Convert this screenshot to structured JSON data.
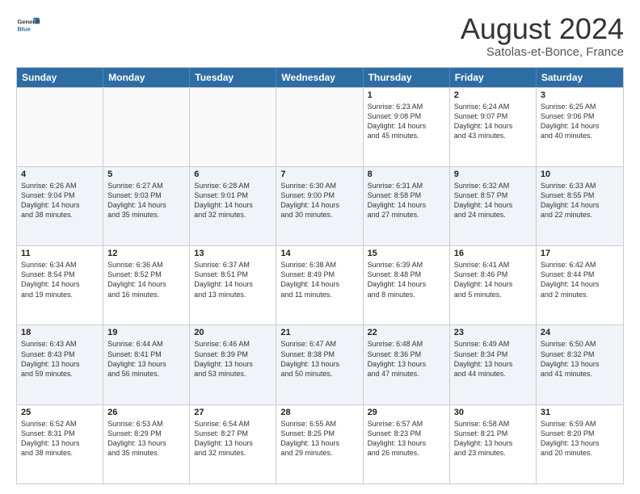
{
  "logo": {
    "general": "General",
    "blue": "Blue"
  },
  "title": "August 2024",
  "subtitle": "Satolas-et-Bonce, France",
  "header_days": [
    "Sunday",
    "Monday",
    "Tuesday",
    "Wednesday",
    "Thursday",
    "Friday",
    "Saturday"
  ],
  "rows": [
    [
      {
        "day": "",
        "text": "",
        "empty": true
      },
      {
        "day": "",
        "text": "",
        "empty": true
      },
      {
        "day": "",
        "text": "",
        "empty": true
      },
      {
        "day": "",
        "text": "",
        "empty": true
      },
      {
        "day": "1",
        "text": "Sunrise: 6:23 AM\nSunset: 9:08 PM\nDaylight: 14 hours\nand 45 minutes.",
        "empty": false
      },
      {
        "day": "2",
        "text": "Sunrise: 6:24 AM\nSunset: 9:07 PM\nDaylight: 14 hours\nand 43 minutes.",
        "empty": false
      },
      {
        "day": "3",
        "text": "Sunrise: 6:25 AM\nSunset: 9:06 PM\nDaylight: 14 hours\nand 40 minutes.",
        "empty": false
      }
    ],
    [
      {
        "day": "4",
        "text": "Sunrise: 6:26 AM\nSunset: 9:04 PM\nDaylight: 14 hours\nand 38 minutes.",
        "empty": false
      },
      {
        "day": "5",
        "text": "Sunrise: 6:27 AM\nSunset: 9:03 PM\nDaylight: 14 hours\nand 35 minutes.",
        "empty": false
      },
      {
        "day": "6",
        "text": "Sunrise: 6:28 AM\nSunset: 9:01 PM\nDaylight: 14 hours\nand 32 minutes.",
        "empty": false
      },
      {
        "day": "7",
        "text": "Sunrise: 6:30 AM\nSunset: 9:00 PM\nDaylight: 14 hours\nand 30 minutes.",
        "empty": false
      },
      {
        "day": "8",
        "text": "Sunrise: 6:31 AM\nSunset: 8:58 PM\nDaylight: 14 hours\nand 27 minutes.",
        "empty": false
      },
      {
        "day": "9",
        "text": "Sunrise: 6:32 AM\nSunset: 8:57 PM\nDaylight: 14 hours\nand 24 minutes.",
        "empty": false
      },
      {
        "day": "10",
        "text": "Sunrise: 6:33 AM\nSunset: 8:55 PM\nDaylight: 14 hours\nand 22 minutes.",
        "empty": false
      }
    ],
    [
      {
        "day": "11",
        "text": "Sunrise: 6:34 AM\nSunset: 8:54 PM\nDaylight: 14 hours\nand 19 minutes.",
        "empty": false
      },
      {
        "day": "12",
        "text": "Sunrise: 6:36 AM\nSunset: 8:52 PM\nDaylight: 14 hours\nand 16 minutes.",
        "empty": false
      },
      {
        "day": "13",
        "text": "Sunrise: 6:37 AM\nSunset: 8:51 PM\nDaylight: 14 hours\nand 13 minutes.",
        "empty": false
      },
      {
        "day": "14",
        "text": "Sunrise: 6:38 AM\nSunset: 8:49 PM\nDaylight: 14 hours\nand 11 minutes.",
        "empty": false
      },
      {
        "day": "15",
        "text": "Sunrise: 6:39 AM\nSunset: 8:48 PM\nDaylight: 14 hours\nand 8 minutes.",
        "empty": false
      },
      {
        "day": "16",
        "text": "Sunrise: 6:41 AM\nSunset: 8:46 PM\nDaylight: 14 hours\nand 5 minutes.",
        "empty": false
      },
      {
        "day": "17",
        "text": "Sunrise: 6:42 AM\nSunset: 8:44 PM\nDaylight: 14 hours\nand 2 minutes.",
        "empty": false
      }
    ],
    [
      {
        "day": "18",
        "text": "Sunrise: 6:43 AM\nSunset: 8:43 PM\nDaylight: 13 hours\nand 59 minutes.",
        "empty": false
      },
      {
        "day": "19",
        "text": "Sunrise: 6:44 AM\nSunset: 8:41 PM\nDaylight: 13 hours\nand 56 minutes.",
        "empty": false
      },
      {
        "day": "20",
        "text": "Sunrise: 6:46 AM\nSunset: 8:39 PM\nDaylight: 13 hours\nand 53 minutes.",
        "empty": false
      },
      {
        "day": "21",
        "text": "Sunrise: 6:47 AM\nSunset: 8:38 PM\nDaylight: 13 hours\nand 50 minutes.",
        "empty": false
      },
      {
        "day": "22",
        "text": "Sunrise: 6:48 AM\nSunset: 8:36 PM\nDaylight: 13 hours\nand 47 minutes.",
        "empty": false
      },
      {
        "day": "23",
        "text": "Sunrise: 6:49 AM\nSunset: 8:34 PM\nDaylight: 13 hours\nand 44 minutes.",
        "empty": false
      },
      {
        "day": "24",
        "text": "Sunrise: 6:50 AM\nSunset: 8:32 PM\nDaylight: 13 hours\nand 41 minutes.",
        "empty": false
      }
    ],
    [
      {
        "day": "25",
        "text": "Sunrise: 6:52 AM\nSunset: 8:31 PM\nDaylight: 13 hours\nand 38 minutes.",
        "empty": false
      },
      {
        "day": "26",
        "text": "Sunrise: 6:53 AM\nSunset: 8:29 PM\nDaylight: 13 hours\nand 35 minutes.",
        "empty": false
      },
      {
        "day": "27",
        "text": "Sunrise: 6:54 AM\nSunset: 8:27 PM\nDaylight: 13 hours\nand 32 minutes.",
        "empty": false
      },
      {
        "day": "28",
        "text": "Sunrise: 6:55 AM\nSunset: 8:25 PM\nDaylight: 13 hours\nand 29 minutes.",
        "empty": false
      },
      {
        "day": "29",
        "text": "Sunrise: 6:57 AM\nSunset: 8:23 PM\nDaylight: 13 hours\nand 26 minutes.",
        "empty": false
      },
      {
        "day": "30",
        "text": "Sunrise: 6:58 AM\nSunset: 8:21 PM\nDaylight: 13 hours\nand 23 minutes.",
        "empty": false
      },
      {
        "day": "31",
        "text": "Sunrise: 6:59 AM\nSunset: 8:20 PM\nDaylight: 13 hours\nand 20 minutes.",
        "empty": false
      }
    ]
  ]
}
